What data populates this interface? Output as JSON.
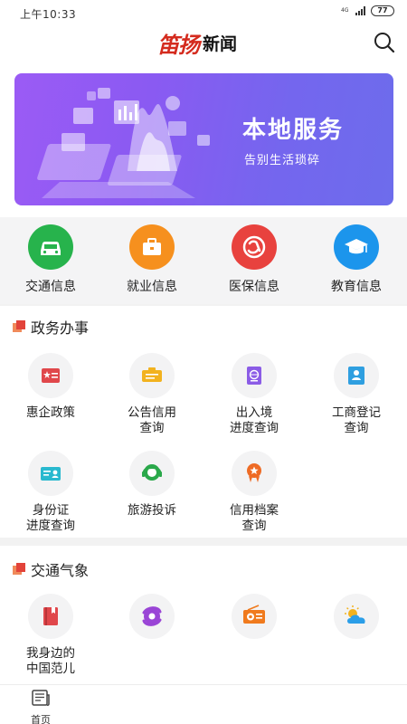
{
  "status_bar": {
    "time": "上午10:33",
    "network": "4G",
    "battery": "77"
  },
  "header": {
    "logo_mark": "笛扬",
    "logo_text": "新闻"
  },
  "banner": {
    "title": "本地服务",
    "subtitle": "告别生活琐碎"
  },
  "quick_services": [
    {
      "label": "交通信息",
      "icon": "car-icon",
      "color": "#27b34c"
    },
    {
      "label": "就业信息",
      "icon": "briefcase-icon",
      "color": "#f6901e"
    },
    {
      "label": "医保信息",
      "icon": "social-security-icon",
      "color": "#e8423e"
    },
    {
      "label": "教育信息",
      "icon": "graduation-cap-icon",
      "color": "#1c95ec"
    }
  ],
  "government": {
    "title": "政务办事",
    "items": [
      {
        "label": "惠企政策",
        "icon": "policy-card-icon",
        "color": "#e0474b"
      },
      {
        "label": "公告信用\n查询",
        "icon": "notice-icon",
        "color": "#f2b21e"
      },
      {
        "label": "出入境\n进度查询",
        "icon": "passport-icon",
        "color": "#8b5ce6"
      },
      {
        "label": "工商登记\n查询",
        "icon": "business-registration-icon",
        "color": "#2f9fe0"
      },
      {
        "label": "身份证\n进度查询",
        "icon": "id-card-icon",
        "color": "#29b9cf"
      },
      {
        "label": "旅游投诉",
        "icon": "customer-service-icon",
        "color": "#2aa84a"
      },
      {
        "label": "信用档案\n查询",
        "icon": "credit-badge-icon",
        "color": "#ee6b25"
      }
    ]
  },
  "traffic": {
    "title": "交通气象",
    "items": [
      {
        "label": "我身边的\n中国范儿",
        "icon": "book-icon",
        "color": "#e0474b"
      },
      {
        "label": "",
        "icon": "typhoon-icon",
        "color": "#9a45d6"
      },
      {
        "label": "",
        "icon": "radio-icon",
        "color": "#f07a1d"
      },
      {
        "label": "",
        "icon": "weather-icon",
        "color": "#2b9ee8"
      }
    ]
  },
  "bottom_nav": {
    "home_label": "首页"
  }
}
